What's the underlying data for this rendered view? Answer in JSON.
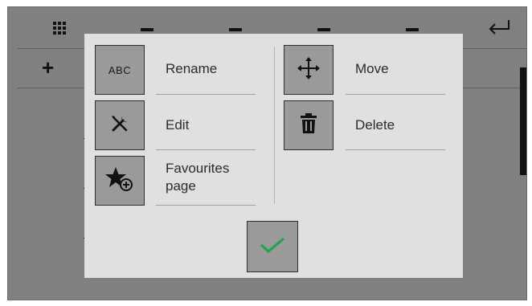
{
  "toolbar": {
    "grid_icon": "grid-icon",
    "back_icon": "return-icon",
    "add_label": "+"
  },
  "dialog": {
    "actions": [
      {
        "label": "Rename",
        "icon_text": "ABC",
        "icon": "abc-text-icon"
      },
      {
        "label": "Edit",
        "icon": "tools-icon"
      },
      {
        "label": "Favourites page",
        "icon": "star-add-icon"
      },
      {
        "label": "Move",
        "icon": "move-arrows-icon"
      },
      {
        "label": "Delete",
        "icon": "trash-icon"
      }
    ],
    "confirm_icon": "checkmark-icon"
  },
  "colors": {
    "panel": "#808080",
    "dialog": "#e0e0e0",
    "button": "#9a9a9a",
    "check": "#1aa54a"
  }
}
